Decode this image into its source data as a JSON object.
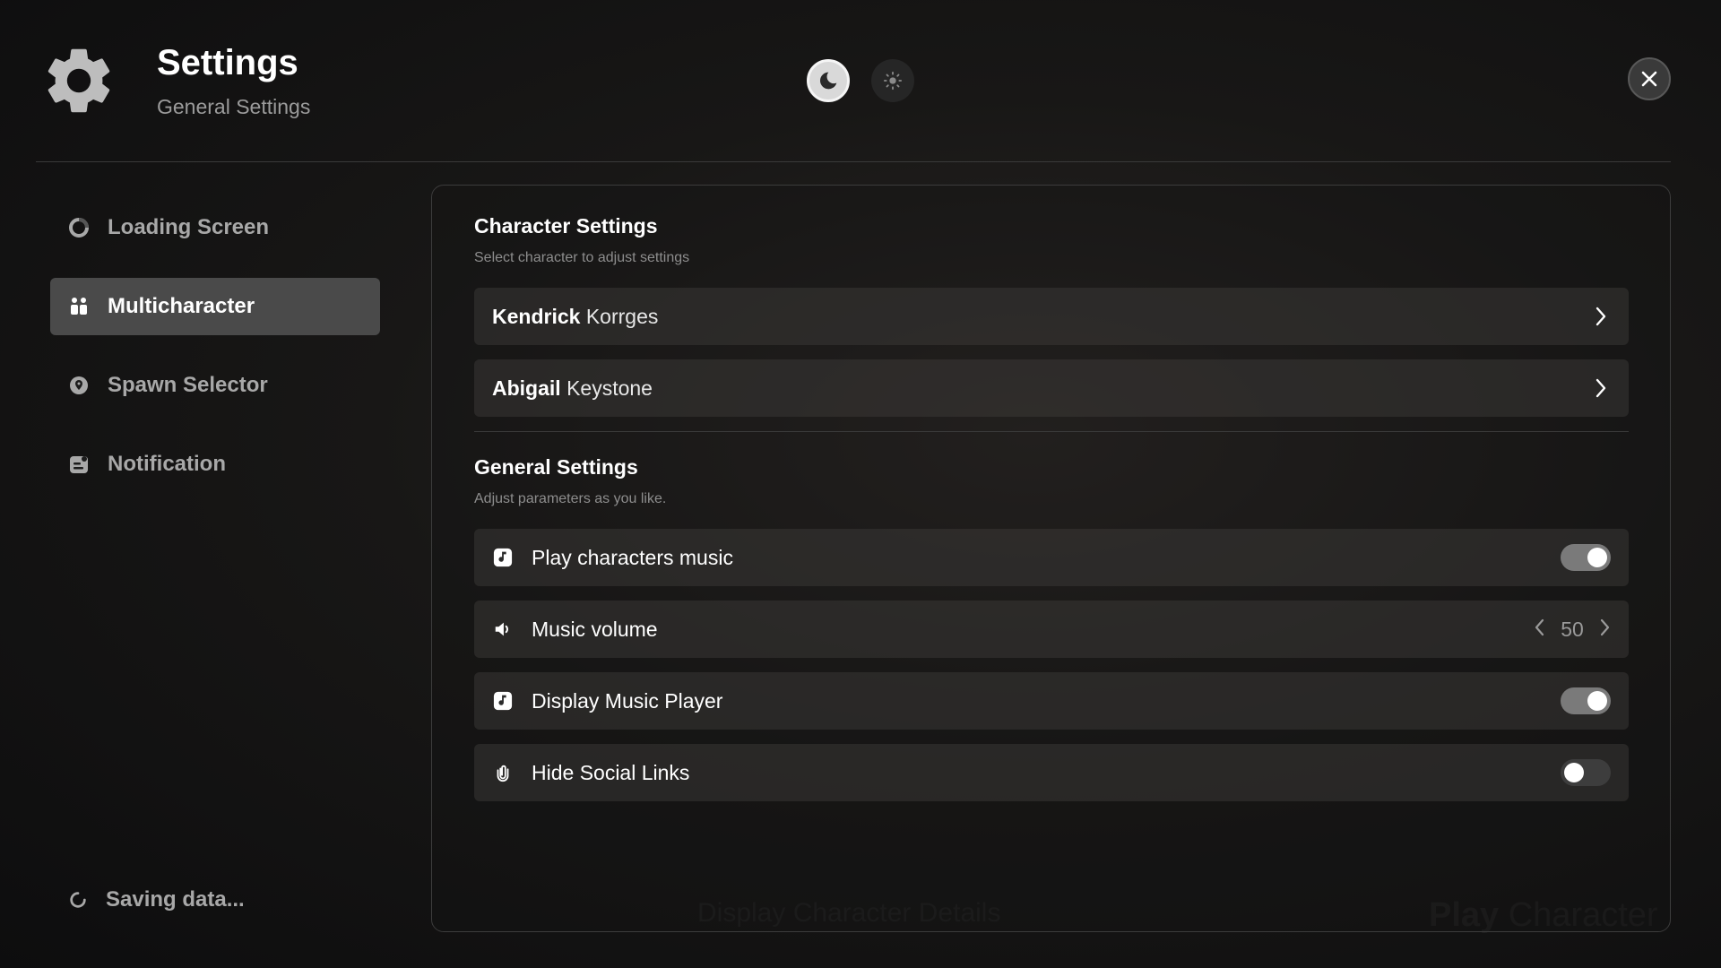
{
  "header": {
    "title": "Settings",
    "subtitle": "General Settings"
  },
  "theme": {
    "selected": "dark"
  },
  "sidebar": {
    "items": [
      {
        "label": "Loading Screen",
        "icon": "loading-icon",
        "active": false
      },
      {
        "label": "Multicharacter",
        "icon": "users-icon",
        "active": true
      },
      {
        "label": "Spawn Selector",
        "icon": "location-icon",
        "active": false
      },
      {
        "label": "Notification",
        "icon": "notification-icon",
        "active": false
      }
    ],
    "status": "Saving data..."
  },
  "character_settings": {
    "title": "Character Settings",
    "description": "Select character to adjust settings",
    "characters": [
      {
        "first": "Kendrick",
        "last": "Korrges"
      },
      {
        "first": "Abigail",
        "last": "Keystone"
      }
    ]
  },
  "general_settings": {
    "title": "General Settings",
    "description": "Adjust parameters as you like.",
    "options": [
      {
        "label": "Play characters music",
        "icon": "music-note-icon",
        "type": "toggle",
        "value": true
      },
      {
        "label": "Music volume",
        "icon": "speaker-icon",
        "type": "stepper",
        "value": "50"
      },
      {
        "label": "Display Music Player",
        "icon": "music-note-icon",
        "type": "toggle",
        "value": true
      },
      {
        "label": "Hide Social Links",
        "icon": "link-icon",
        "type": "toggle",
        "value": false
      }
    ]
  },
  "background": {
    "left_text": "Display Character Details",
    "right_text_bold": "Play",
    "right_text_light": "Character"
  },
  "colors": {
    "accent_active": "#4a4a4a",
    "toggle_on": "#7a7a7a",
    "toggle_off": "#3d3d3d"
  }
}
